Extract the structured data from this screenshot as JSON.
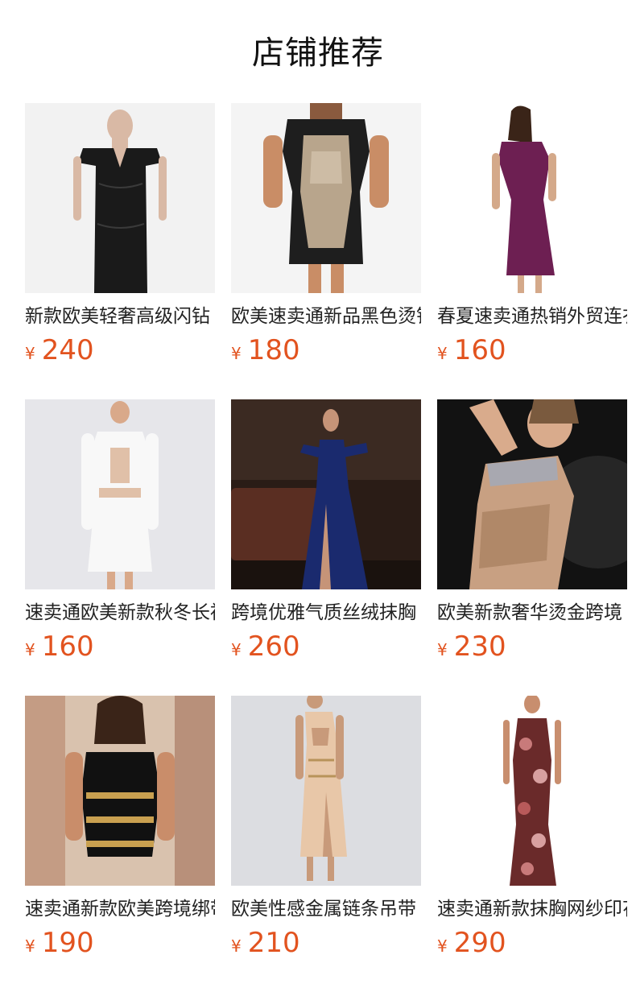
{
  "header": {
    "title": "店铺推荐"
  },
  "currency_symbol": "¥",
  "products": [
    {
      "name": "新款欧美轻奢高级闪钻",
      "price": "240",
      "image": "black-sequin-off-shoulder-dress"
    },
    {
      "name": "欧美速卖通新品黑色烫钻",
      "price": "180",
      "image": "black-rhinestone-bodycon-dress"
    },
    {
      "name": "春夏速卖通热销外贸连衣裙",
      "price": "160",
      "image": "purple-cap-sleeve-dress"
    },
    {
      "name": "速卖通欧美新款秋冬长袖",
      "price": "160",
      "image": "white-cutout-bandage-dress"
    },
    {
      "name": "跨境优雅气质丝绒抹胸",
      "price": "260",
      "image": "navy-velvet-gown"
    },
    {
      "name": "欧美新款奢华烫金跨境",
      "price": "230",
      "image": "gold-beaded-dress"
    },
    {
      "name": "速卖通新款欧美跨境绑带",
      "price": "190",
      "image": "black-buckle-dress"
    },
    {
      "name": "欧美性感金属链条吊带",
      "price": "210",
      "image": "nude-chain-slit-dress"
    },
    {
      "name": "速卖通新款抹胸网纱印花",
      "price": "290",
      "image": "floral-strapless-maxi-dress"
    }
  ]
}
